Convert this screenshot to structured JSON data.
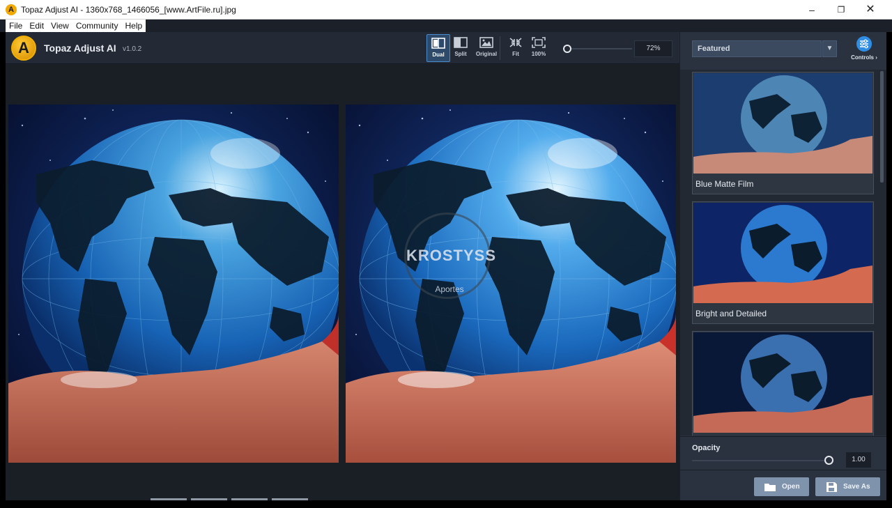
{
  "window": {
    "title": "Topaz Adjust AI - 1360x768_1466056_[www.ArtFile.ru].jpg",
    "app_icon_glyph": "A",
    "controls": [
      "minimize-icon",
      "maximize-icon",
      "close-icon"
    ]
  },
  "menu": {
    "items": [
      "File",
      "Edit",
      "View",
      "Community",
      "Help"
    ]
  },
  "toolbar": {
    "logo_glyph": "A",
    "app_name": "Topaz Adjust AI",
    "version": "v1.0.2",
    "view_modes": [
      {
        "label": "Dual",
        "icon": "dual-view-icon",
        "active": true
      },
      {
        "label": "Split",
        "icon": "split-view-icon",
        "active": false
      },
      {
        "label": "Original",
        "icon": "original-view-icon",
        "active": false
      }
    ],
    "fit_label": "Fit",
    "zoom100_label": "100%",
    "zoom_value": "72%"
  },
  "canvas": {
    "watermark_main": "KROSTYSS",
    "watermark_sub": "Aportes"
  },
  "panel": {
    "preset_category": "Featured",
    "controls_label": "Controls ›",
    "presets": [
      {
        "name": "Blue Matte Film"
      },
      {
        "name": "Bright and Detailed"
      },
      {
        "name": ""
      }
    ],
    "opacity_label": "Opacity",
    "opacity_value": "1.00",
    "open_label": "Open",
    "save_as_label": "Save As"
  },
  "colors": {
    "accent": "#2f8de4",
    "logo": "#f2a900",
    "panel_bg": "#2a323f",
    "button": "#7f93ad"
  }
}
